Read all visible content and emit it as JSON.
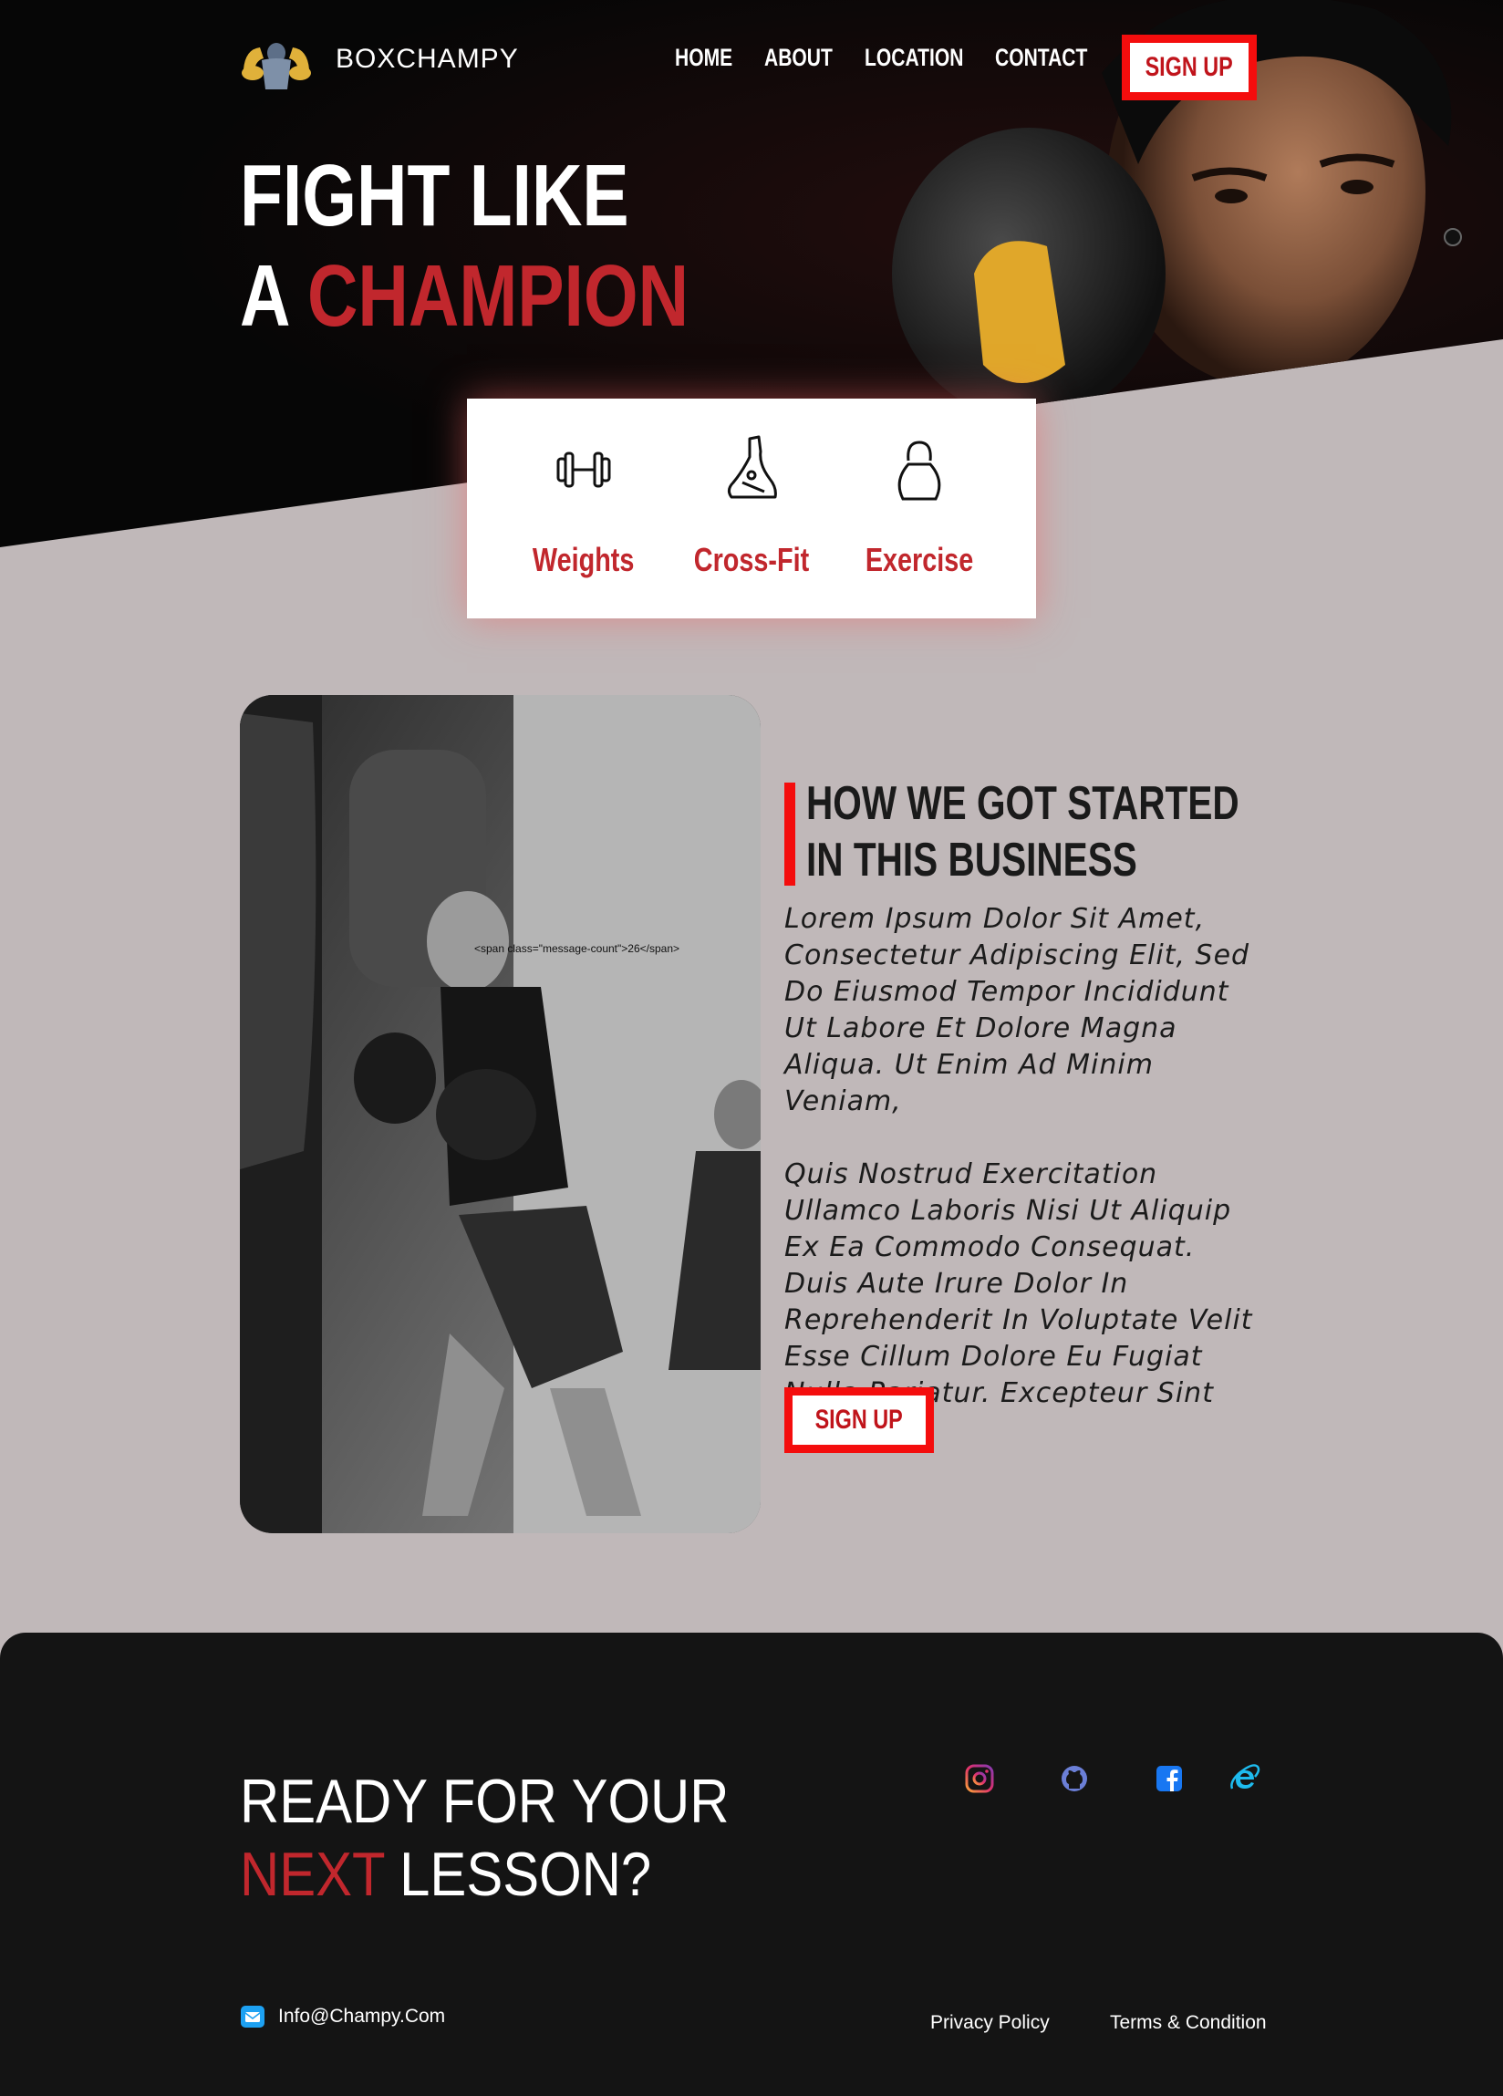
{
  "brand": {
    "name": "BOXCHAMPY"
  },
  "nav": {
    "home": "HOME",
    "about": "ABOUT",
    "location": "LOCATION",
    "contact": "CONTACT"
  },
  "hero": {
    "signup": "SIGN UP",
    "title_line1": "FIGHT  LIKE",
    "title_line2_prefix": "A ",
    "title_line2_highlight": "CHAMPION"
  },
  "features": [
    {
      "label": "Weights",
      "icon": "dumbbell-icon"
    },
    {
      "label": "Cross-Fit",
      "icon": "sneaker-icon"
    },
    {
      "label": "Exercise",
      "icon": "kettlebell-icon"
    }
  ],
  "about": {
    "photo_caption": "<span class=\"message-count\">26</span>",
    "title_line1": "HOW WE GOT STARTED",
    "title_line2": "IN THIS BUSINESS",
    "paragraph1": "Lorem Ipsum Dolor Sit Amet, Consectetur Adipiscing Elit, Sed Do Eiusmod Tempor Incididunt Ut Labore Et Dolore Magna Aliqua. Ut Enim Ad Minim Veniam,",
    "paragraph2": "Quis Nostrud Exercitation Ullamco Laboris Nisi Ut Aliquip Ex Ea Commodo Consequat. Duis Aute Irure Dolor In Reprehenderit In Voluptate Velit Esse Cillum Dolore Eu Fugiat Nulla Pariatur. Excepteur Sint Occaecat",
    "signup": "SIGN UP"
  },
  "footer": {
    "cta_line1": "READY FOR YOUR",
    "cta_line2_highlight": "NEXT",
    "cta_line2_rest": " LESSON?",
    "social": [
      "instagram-icon",
      "github-icon",
      "facebook-icon",
      "internet-explorer-icon"
    ],
    "email": "Info@Champy.Com",
    "privacy": "Privacy Policy",
    "terms": "Terms & Condition"
  },
  "colors": {
    "accent": "#c1272d",
    "button_red": "#f40d0d",
    "page_bg": "#c0b8b9",
    "dark": "#141414"
  }
}
